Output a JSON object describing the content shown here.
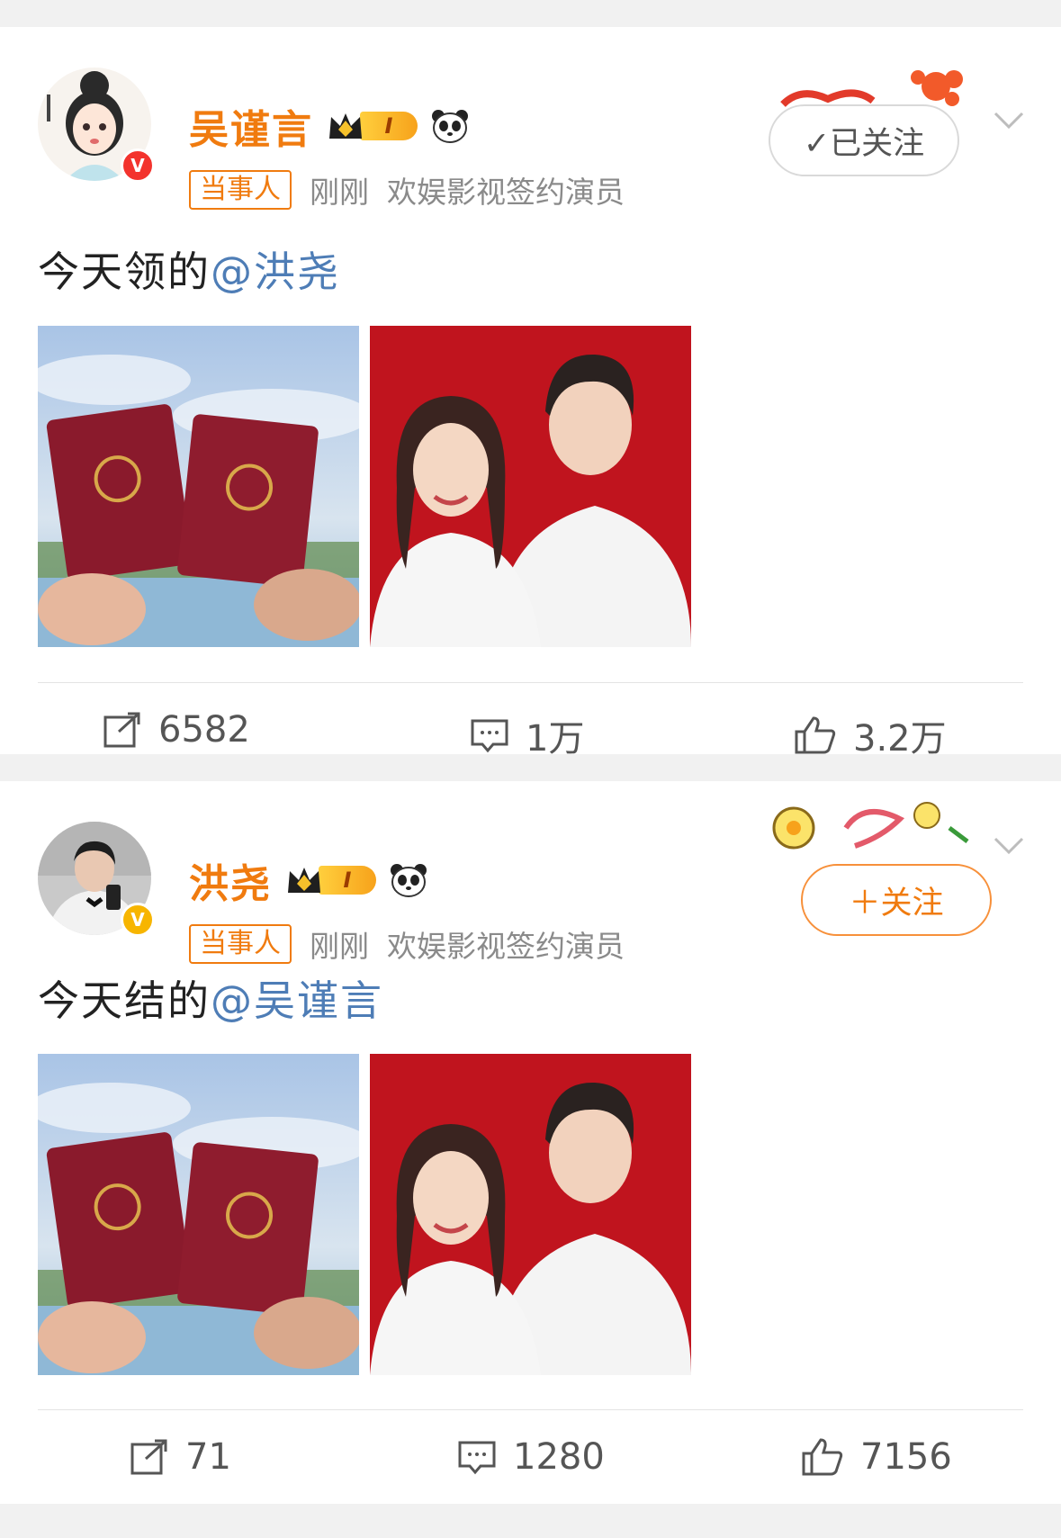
{
  "posts": [
    {
      "username": "吴谨言",
      "vip_level": "I",
      "tag": "当事人",
      "time": "刚刚",
      "source": "欢娱影视签约演员",
      "follow_label": "✓已关注",
      "text_prefix": "今天领的",
      "mention": "@洪尧",
      "repost_count": "6582",
      "comment_count": "1万",
      "like_count": "3.2万",
      "verified_color": "#f3332d"
    },
    {
      "username": "洪尧",
      "vip_level": "I",
      "tag": "当事人",
      "time": "刚刚",
      "source": "欢娱影视签约演员",
      "follow_label": "＋关注",
      "text_prefix": "今天结的",
      "mention": "@吴谨言",
      "repost_count": "71",
      "comment_count": "1280",
      "like_count": "7156",
      "verified_color": "#f7b500"
    }
  ],
  "icons": [
    "repost-icon",
    "comment-icon",
    "like-icon",
    "chevron-down-icon",
    "panda-icon",
    "vip-crown-icon",
    "verified-badge-icon"
  ],
  "colors": {
    "username": "#f07b0f",
    "mention": "#4e7db6",
    "meta": "#8a8a8a",
    "background": "#f1f1f1"
  }
}
